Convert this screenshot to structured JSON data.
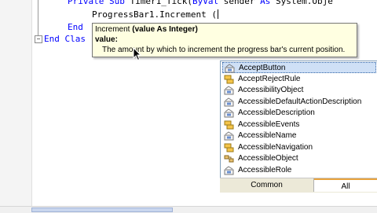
{
  "code": {
    "line1": {
      "kw1": "Private",
      "kw2": "Sub",
      "name": "Timer1_Tick(",
      "kw3": "ByVal",
      "mid": "sender",
      "kw4": "As",
      "rest": "System.Obje"
    },
    "line2": {
      "text": "ProgressBar1.Increment ("
    },
    "line3": {
      "kw": "End"
    },
    "line4": {
      "kw1": "End",
      "kw2": "Clas"
    }
  },
  "tooltip": {
    "name": "Increment",
    "signature": "(value As Integer)",
    "param": "value:",
    "description": "The amount by which to increment the progress bar's current position."
  },
  "completion_list": {
    "items": [
      {
        "label": "AcceptButton",
        "icon": "property-icon",
        "selected": true
      },
      {
        "label": "AcceptRejectRule",
        "icon": "enum-icon",
        "selected": false
      },
      {
        "label": "AccessibilityObject",
        "icon": "property-icon",
        "selected": false
      },
      {
        "label": "AccessibleDefaultActionDescription",
        "icon": "property-icon",
        "selected": false
      },
      {
        "label": "AccessibleDescription",
        "icon": "property-icon",
        "selected": false
      },
      {
        "label": "AccessibleEvents",
        "icon": "enum-icon",
        "selected": false
      },
      {
        "label": "AccessibleName",
        "icon": "property-icon",
        "selected": false
      },
      {
        "label": "AccessibleNavigation",
        "icon": "enum-icon",
        "selected": false
      },
      {
        "label": "AccessibleObject",
        "icon": "class-icon",
        "selected": false
      },
      {
        "label": "AccessibleRole",
        "icon": "property-icon",
        "selected": false
      }
    ],
    "tabs": {
      "common": "Common",
      "all": "All"
    },
    "active_tab": "all"
  },
  "colors": {
    "keyword": "#0000ff",
    "tooltip_bg": "#ffffe1",
    "selection": "#cfe0f6",
    "tab_active_border": "#e8a23c"
  }
}
